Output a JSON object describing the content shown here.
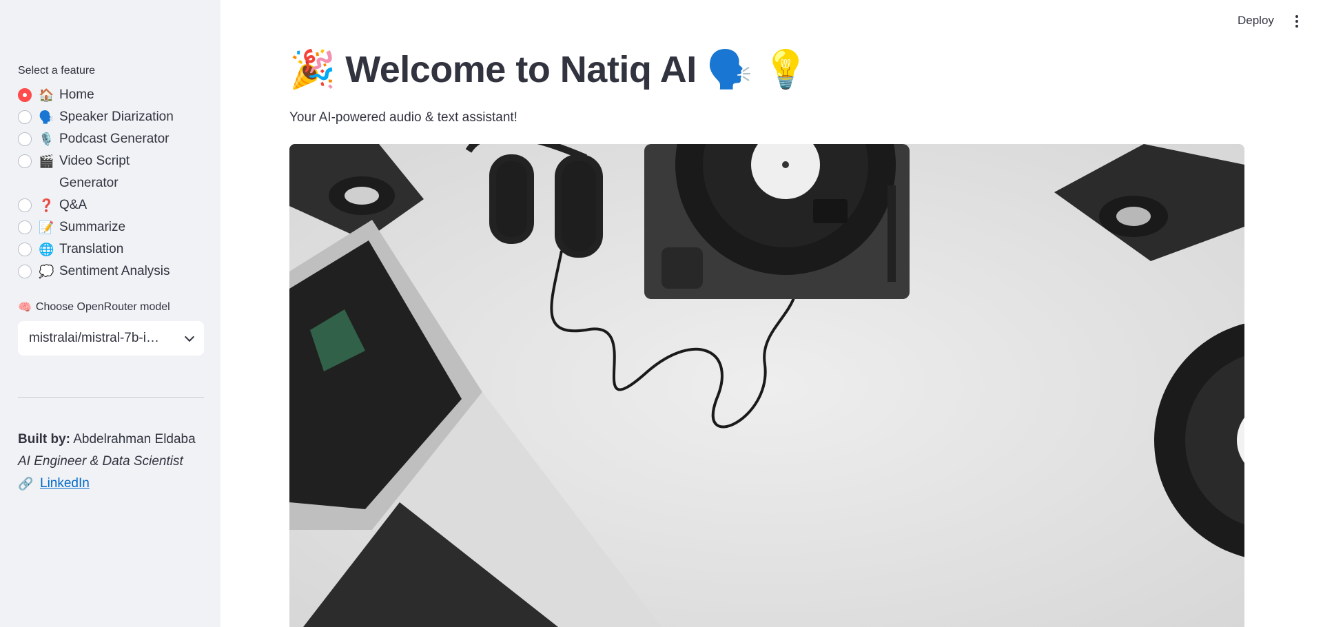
{
  "sidebar": {
    "feature_label": "Select a feature",
    "features": [
      {
        "emoji": "🏠",
        "label": "Home",
        "selected": true
      },
      {
        "emoji": "🗣️",
        "label": "Speaker Diarization",
        "selected": false
      },
      {
        "emoji": "🎙️",
        "label": "Podcast Generator",
        "selected": false
      },
      {
        "emoji": "🎬",
        "label": "Video Script Generator",
        "selected": false
      },
      {
        "emoji": "❓",
        "label": "Q&A",
        "selected": false
      },
      {
        "emoji": "📝",
        "label": "Summarize",
        "selected": false
      },
      {
        "emoji": "🌐",
        "label": "Translation",
        "selected": false
      },
      {
        "emoji": "💭",
        "label": "Sentiment Analysis",
        "selected": false
      }
    ],
    "model_label_emoji": "🧠",
    "model_label": "Choose OpenRouter model",
    "model_selected": "mistralai/mistral-7b-i…",
    "built_by_label": "Built by:",
    "built_by_name": " Abdelrahman Eldaba",
    "role": "AI Engineer & Data Scientist",
    "link_icon": "🔗",
    "linkedin_label": "LinkedIn"
  },
  "header": {
    "deploy_label": "Deploy",
    "menu_icon": "kebab-menu-icon"
  },
  "main": {
    "title": "🎉 Welcome to Natiq AI 🗣️ 💡",
    "subtitle": "Your AI-powered audio & text assistant!"
  },
  "colors": {
    "accent": "#ff4b4b",
    "sidebar_bg": "#f0f2f6",
    "link": "#0068c9",
    "text": "#31333f"
  }
}
